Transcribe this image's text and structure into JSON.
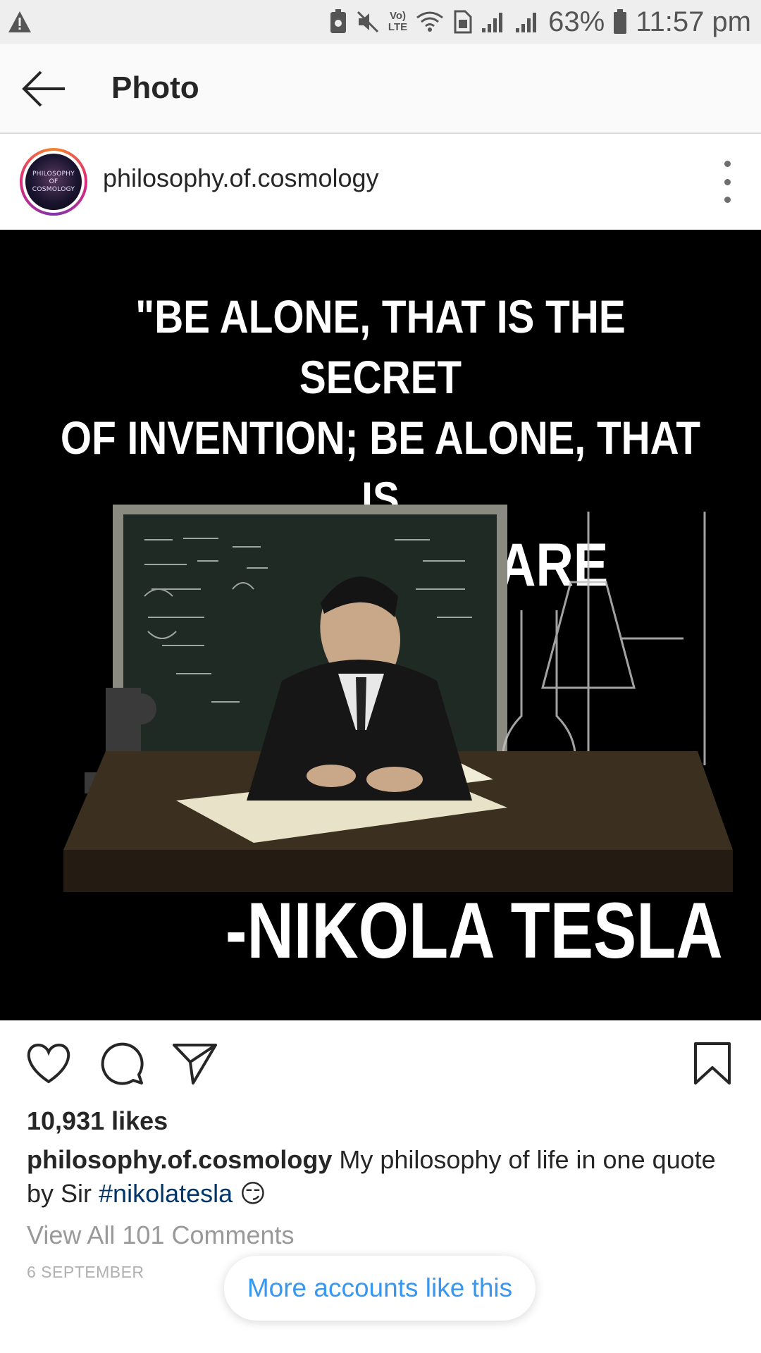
{
  "status_bar": {
    "battery": "63%",
    "time": "11:57 pm",
    "lte_label": "LTE",
    "volte_label": "Vo)"
  },
  "app_bar": {
    "title": "Photo"
  },
  "post": {
    "username": "philosophy.of.cosmology",
    "avatar_text": [
      "PHILOSOPHY",
      "OF",
      "COSMOLOGY"
    ],
    "image": {
      "quote_lines": [
        "\"BE ALONE, THAT IS THE SECRET",
        "OF INVENTION; BE ALONE, THAT IS",
        "WHEN IDEAS ARE BORN.\""
      ],
      "attribution": "-NIKOLA TESLA"
    },
    "likes": "10,931 likes",
    "caption": {
      "user": "philosophy.of.cosmology",
      "text": " My philosophy of life in one quote by Sir ",
      "hashtag": "#nikolatesla",
      "emoji": "😏"
    },
    "view_comments": "View All 101 Comments",
    "date": "6 SEPTEMBER"
  },
  "more_accounts_label": "More accounts like this",
  "colors": {
    "link_blue": "#3897f0",
    "hashtag_blue": "#003569",
    "status_bar_bg": "#eeeeee"
  }
}
